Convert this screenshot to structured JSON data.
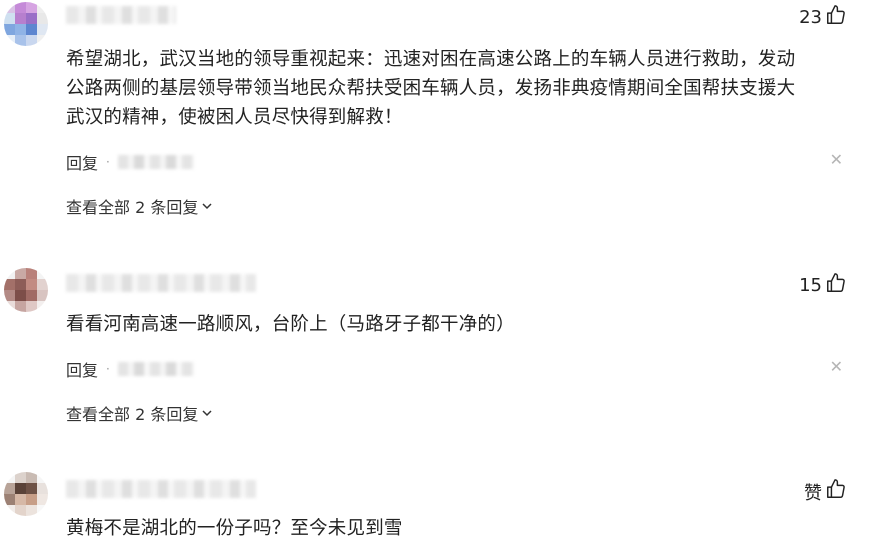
{
  "comments": [
    {
      "likes": "23",
      "text_lines": [
        "希望湖北，武汉当地的领导重视起来：迅速对困在高速公路上的车辆人员进行救助，发动",
        "公路两侧的基层领导带领当地民众帮扶受困车辆人员，发扬非典疫情期间全国帮扶支援大",
        "武汉的精神，使被困人员尽快得到解救！"
      ],
      "reply_label": "回复",
      "close_glyph": "✕",
      "view_all_label": "查看全部 2 条回复"
    },
    {
      "likes": "15",
      "text_lines": [
        "看看河南高速一路顺风，台阶上（马路牙子都干净的）"
      ],
      "reply_label": "回复",
      "close_glyph": "✕",
      "view_all_label": "查看全部 2 条回复"
    },
    {
      "likes": "赞",
      "text_lines": [
        "黄梅不是湖北的一份子吗？至今未见到雪"
      ]
    }
  ],
  "icons": {
    "like": "thumbs-up-icon",
    "close": "close-icon",
    "expand": "chevron-down-icon"
  },
  "colors": {
    "text": "#222222",
    "muted": "#333333",
    "close": "#b5b5b5"
  }
}
